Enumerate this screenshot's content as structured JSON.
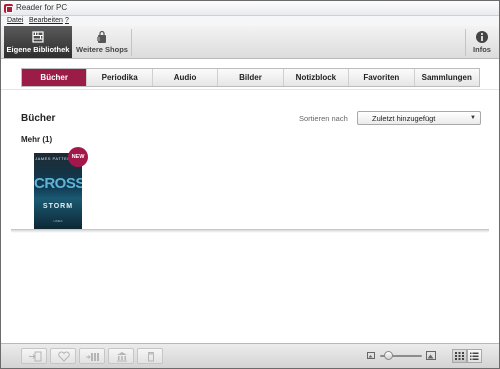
{
  "window": {
    "title": "Reader for PC"
  },
  "menubar": {
    "items": [
      {
        "label": "Datei"
      },
      {
        "label": "Bearbeiten"
      },
      {
        "label": "?"
      }
    ]
  },
  "toolbar": {
    "library_label": "Eigene Bibliothek",
    "shops_label": "Weitere Shops",
    "info_label": "Infos"
  },
  "tabs": [
    {
      "label": "Bücher",
      "active": true
    },
    {
      "label": "Periodika"
    },
    {
      "label": "Audio"
    },
    {
      "label": "Bilder"
    },
    {
      "label": "Notizblock"
    },
    {
      "label": "Favoriten"
    },
    {
      "label": "Sammlungen"
    }
  ],
  "main": {
    "section_title": "Bücher",
    "sort": {
      "label": "Sortieren nach",
      "selected": "Zuletzt hinzugefügt"
    },
    "group_title": "Mehr (1)",
    "books": [
      {
        "author": "JAMES PATTERSON",
        "title_big": "CROSS",
        "title_sub": "STORM",
        "publisher": "LIMES",
        "badge": "NEW"
      }
    ]
  },
  "colors": {
    "accent": "#9b1c46",
    "badge": "#a2184a",
    "toolbar_active": "#3a3a3a"
  },
  "bottombar": {
    "buttons": [
      "send-to-device-icon",
      "favorite-heart-icon",
      "add-to-collection-icon",
      "library-icon",
      "trash-icon"
    ],
    "zoom_level": 0.2,
    "view_modes": [
      "grid-view-icon",
      "list-view-icon"
    ],
    "active_view": "grid-view-icon"
  }
}
